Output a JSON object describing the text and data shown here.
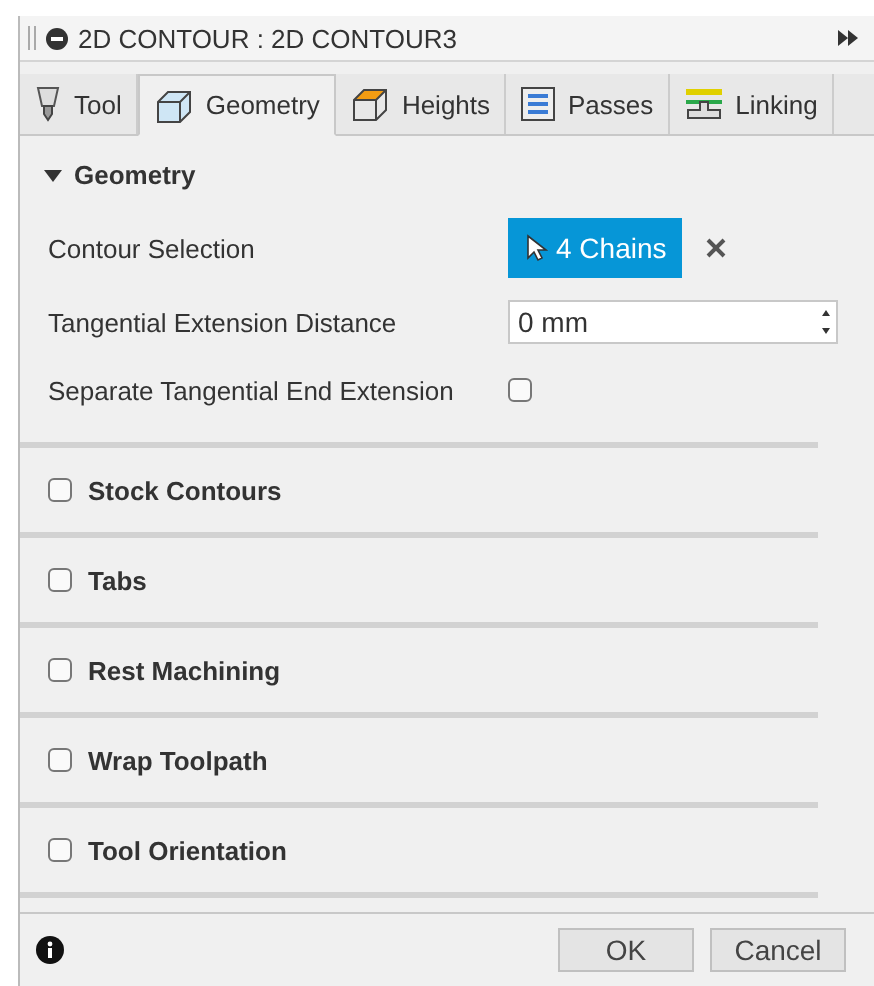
{
  "window": {
    "title": "2D CONTOUR : 2D CONTOUR3"
  },
  "tabs": [
    {
      "label": "Tool",
      "kind": "tool",
      "selected": false
    },
    {
      "label": "Geometry",
      "kind": "geometry",
      "selected": true
    },
    {
      "label": "Heights",
      "kind": "heights",
      "selected": false
    },
    {
      "label": "Passes",
      "kind": "passes",
      "selected": false
    },
    {
      "label": "Linking",
      "kind": "linking",
      "selected": false
    }
  ],
  "geometry": {
    "title": "Geometry",
    "expanded": true,
    "fields": [
      {
        "kind": "selection",
        "label": "Contour Selection",
        "value": "4 Chains"
      },
      {
        "kind": "number",
        "label": "Tangential Extension Distance",
        "value": "0 mm"
      },
      {
        "kind": "checkbox",
        "label": "Separate Tangential End Extension",
        "checked": false
      }
    ]
  },
  "sections": [
    {
      "title": "Stock Contours",
      "checked": false
    },
    {
      "title": "Tabs",
      "checked": false
    },
    {
      "title": "Rest Machining",
      "checked": false
    },
    {
      "title": "Wrap Toolpath",
      "checked": false
    },
    {
      "title": "Tool Orientation",
      "checked": false
    }
  ],
  "buttons": [
    "OK",
    "Cancel"
  ]
}
